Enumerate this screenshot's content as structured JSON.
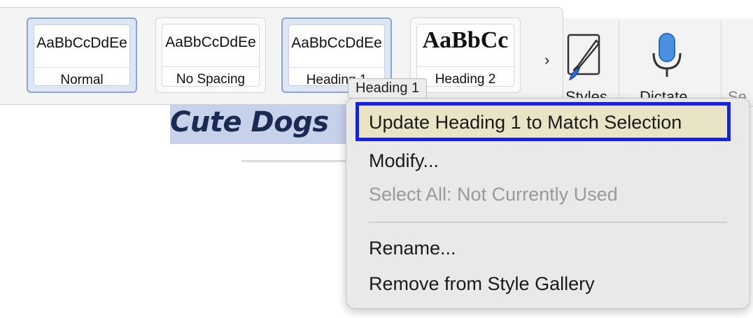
{
  "style_gallery": {
    "styles": [
      {
        "sample": "AaBbCcDdEe",
        "label": "Normal"
      },
      {
        "sample": "AaBbCcDdEe",
        "label": "No Spacing"
      },
      {
        "sample": "AaBbCcDdEe",
        "label": "Heading 1"
      },
      {
        "sample": "AaBbCc",
        "label": "Heading 2"
      }
    ],
    "more_glyph": "›"
  },
  "ribbon": {
    "styles_label": "Styles",
    "dictate_label": "Dictate",
    "partial_label": "Se"
  },
  "tooltip": "Heading 1",
  "document": {
    "title": "Cute Dogs"
  },
  "context_menu": {
    "items": [
      {
        "label": "Update Heading 1 to Match Selection",
        "enabled": true,
        "highlighted": true
      },
      {
        "label": "Modify...",
        "enabled": true
      },
      {
        "label": "Select All: Not Currently Used",
        "enabled": false
      },
      {
        "label": "Rename...",
        "enabled": true
      },
      {
        "label": "Remove from Style Gallery",
        "enabled": true
      }
    ]
  },
  "colors": {
    "highlight_border": "#1622e8",
    "highlight_fill": "#e9e4c6",
    "selection": "#c6d2ea",
    "title_text": "#1b2a52"
  }
}
